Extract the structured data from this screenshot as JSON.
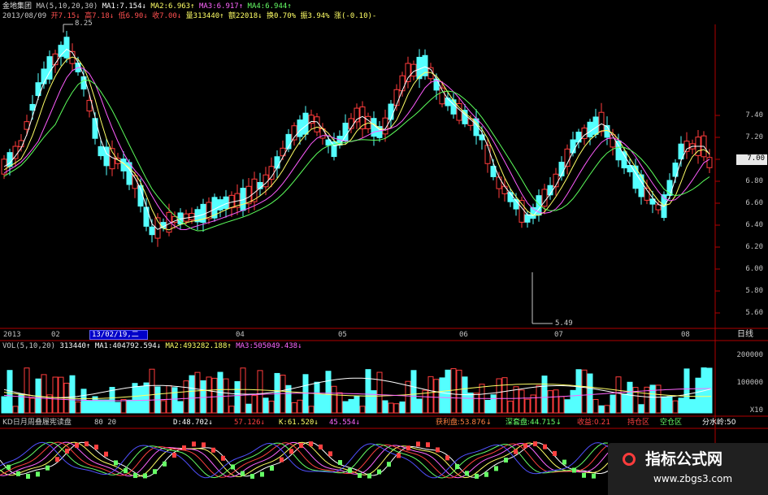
{
  "main_header": {
    "name": "金地集团",
    "ma_params": "MA(5,10,20,30)",
    "ma1": "MA1:7.154↓",
    "ma2": "MA2:6.963↑",
    "ma3": "MA3:6.917↑",
    "ma4": "MA4:6.944↑"
  },
  "quote_line": {
    "date": "2013/08/09",
    "open": "开7.15↓",
    "high": "高7.18↓",
    "low": "低6.90↓",
    "close": "收7.00↓",
    "volume": "量313440↑",
    "amount": "额22018↓",
    "turnover": "换0.70%",
    "amplitude": "振3.94%",
    "change": "涨(-0.10)-"
  },
  "price_annotations": {
    "high_label": "8.25",
    "low_label": "5.49"
  },
  "price_axis": [
    "7.40",
    "7.20",
    "7.00",
    "6.80",
    "6.60",
    "6.40",
    "6.20",
    "6.00",
    "5.80",
    "5.60"
  ],
  "current_price": "7.00",
  "date_axis": {
    "year": "2013",
    "months": [
      "02",
      "04",
      "05",
      "06",
      "07",
      "08"
    ],
    "cursor_date": "13/02/19,二",
    "period": "日线"
  },
  "volume_header": {
    "params": "VOL(5,10,20)",
    "value": "313440↑",
    "ma1": "MA1:404792.594↓",
    "ma2": "MA2:493282.188↑",
    "ma3": "MA3:505049.438↓"
  },
  "volume_axis": [
    "200000",
    "100000",
    "X10"
  ],
  "indicator_header": {
    "name": "KD日月周叠履宪读盘",
    "params": "80 20",
    "d": "D:48.702↓",
    "j1": "57.126↓",
    "k": "K:61.520↓",
    "j2": "45.554↓",
    "profit": "获利盘:53.876↓",
    "trap": "深套盘:44.715↓",
    "yield": "收益:0.21",
    "zone1": "持仓区",
    "zone2": "空仓区",
    "divider": "分水岭:50"
  },
  "watermark": {
    "title": "指标公式网",
    "url": "www.zbgs3.com"
  },
  "chart_data": {
    "type": "candlestick",
    "price_range": [
      5.49,
      8.25
    ],
    "x_labels": [
      "2013",
      "02",
      "04",
      "05",
      "06",
      "07",
      "08"
    ],
    "y_ticks": [
      7.4,
      7.2,
      7.0,
      6.8,
      6.6,
      6.4,
      6.2,
      6.0,
      5.8,
      5.6
    ],
    "last_close": 7.0,
    "period_high": 8.25,
    "period_low": 5.49,
    "volume_ticks": [
      200000,
      100000
    ],
    "last_volume": 313440,
    "colors": {
      "up": "#ff3c3c",
      "down": "#54ffff",
      "ma1": "#ffffff",
      "ma2": "#ffff66",
      "ma3": "#ff5cff",
      "ma4": "#5cff5c"
    }
  }
}
